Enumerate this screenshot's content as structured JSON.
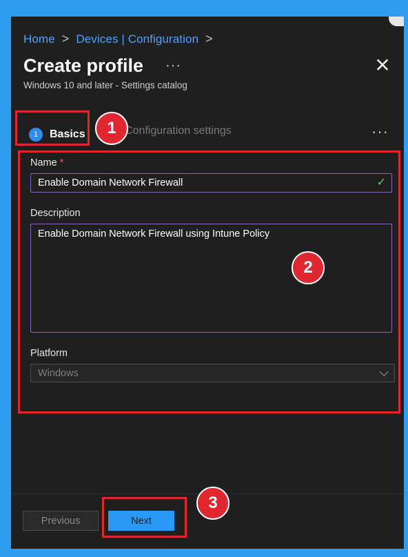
{
  "breadcrumb": {
    "home": "Home",
    "section": "Devices | Configuration",
    "sep": ">"
  },
  "header": {
    "title": "Create profile",
    "more": "···",
    "subtitle": "Windows 10 and later - Settings catalog",
    "close": "✕"
  },
  "tabs": {
    "step_number": "1",
    "basics": "Basics",
    "config": "Configuration settings",
    "more": "···"
  },
  "form": {
    "name_label": "Name",
    "required_mark": "*",
    "name_value": "Enable Domain Network Firewall",
    "valid_mark": "✓",
    "description_label": "Description",
    "description_value": "Enable Domain Network Firewall using Intune Policy",
    "platform_label": "Platform",
    "platform_value": "Windows",
    "platform_chevron": "⌵"
  },
  "footer": {
    "previous": "Previous",
    "next": "Next"
  },
  "annotations": {
    "badge1": "1",
    "badge2": "2",
    "badge3": "3"
  },
  "colors": {
    "accent": "#2899f5",
    "highlight": "#e0262f",
    "link": "#4aa3ff",
    "frame": "#2f9cf0"
  }
}
